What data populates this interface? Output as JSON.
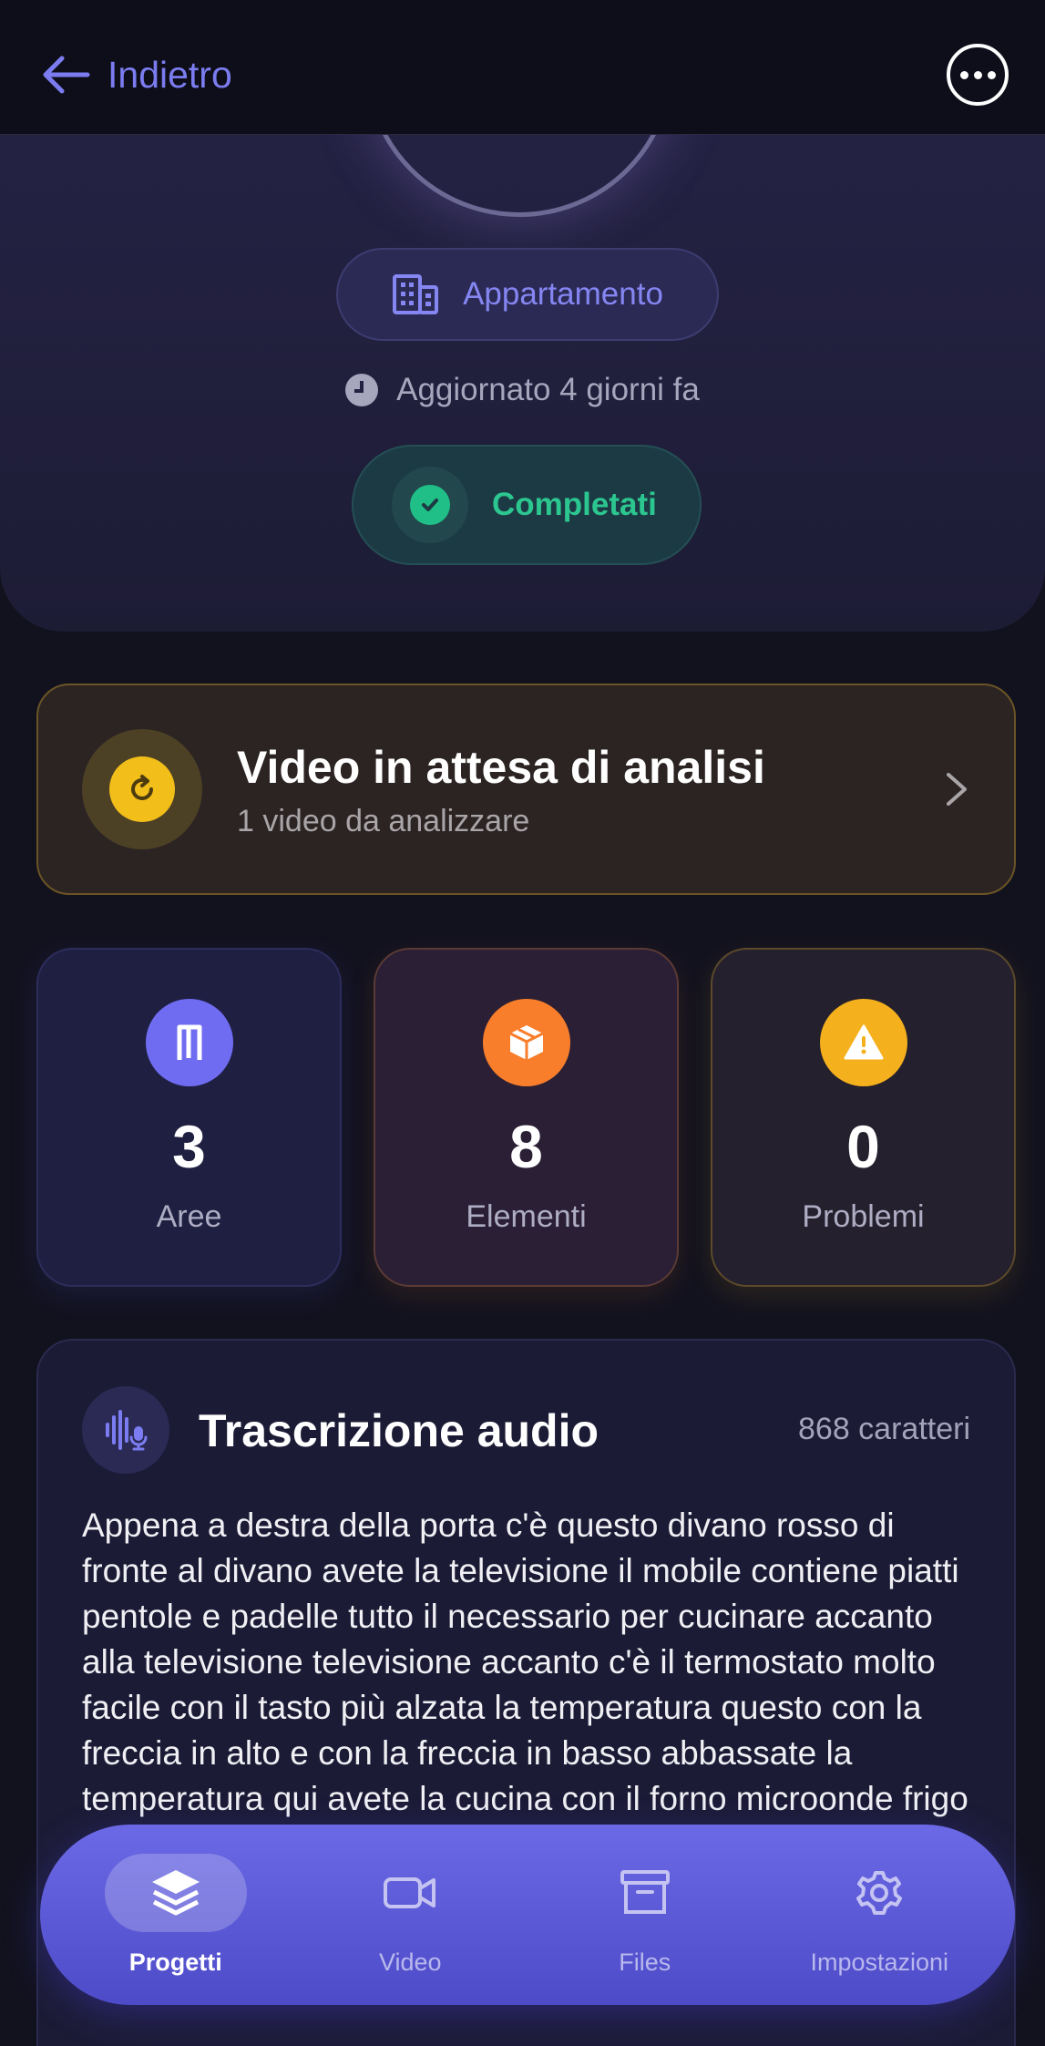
{
  "header": {
    "back_label": "Indietro",
    "back_icon": "arrow-left-icon",
    "more_icon": "ellipsis-circle-icon"
  },
  "project": {
    "type_label": "Appartamento",
    "type_icon": "building-icon",
    "updated_label": "Aggiornato 4 giorni fa",
    "status_label": "Completati",
    "status_color": "#1fbf87"
  },
  "pending_video": {
    "title": "Video in attesa di analisi",
    "subtitle": "1 video da analizzare",
    "icon": "refresh-icon",
    "accent": "#f2be19"
  },
  "stats": [
    {
      "value": "3",
      "label": "Aree",
      "icon": "door-icon",
      "color": "#6f6cf2"
    },
    {
      "value": "8",
      "label": "Elementi",
      "icon": "box-icon",
      "color": "#f97e2b"
    },
    {
      "value": "0",
      "label": "Problemi",
      "icon": "warning-icon",
      "color": "#f4b01d"
    }
  ],
  "transcription": {
    "title": "Trascrizione audio",
    "count": "868 caratteri",
    "icon": "audio-waveform-mic-icon",
    "text": "Appena a destra della porta c'è questo divano rosso di fronte al divano avete la televisione il mobile contiene piatti pentole e padelle tutto il necessario per cucinare accanto alla televisione televisione accanto c'è il termostato molto facile con il tasto più alzata la temperatura questo con la freccia in alto e con la freccia in basso abbassate la temperatura qui avete la cucina con il forno microonde frigo a destra del frigo c'è una stanza"
  },
  "bottom_nav": {
    "items": [
      {
        "label": "Progetti",
        "icon": "layers-icon",
        "active": true
      },
      {
        "label": "Video",
        "icon": "video-camera-icon",
        "active": false
      },
      {
        "label": "Files",
        "icon": "archive-box-icon",
        "active": false
      },
      {
        "label": "Impostazioni",
        "icon": "gear-icon",
        "active": false
      }
    ]
  }
}
